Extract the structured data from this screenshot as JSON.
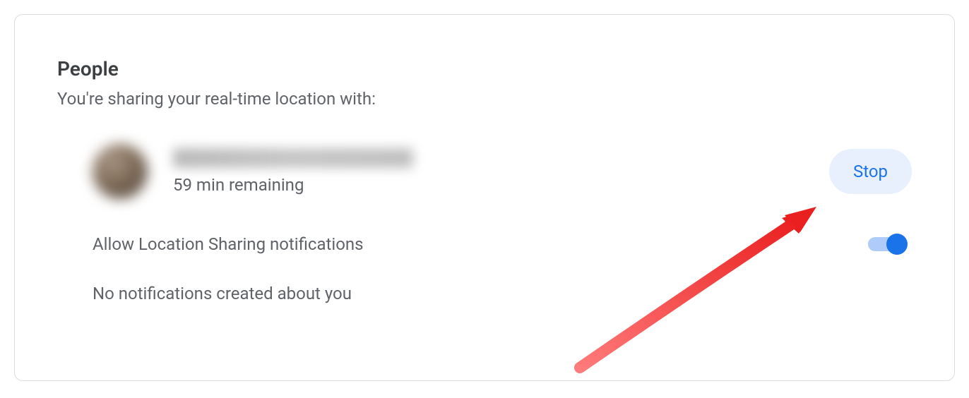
{
  "section": {
    "title": "People",
    "subtitle": "You're sharing your real-time location with:"
  },
  "person": {
    "remaining_text": "59 min remaining",
    "stop_label": "Stop"
  },
  "notifications": {
    "allow_label": "Allow Location Sharing notifications",
    "toggle_on": true,
    "empty_text": "No notifications created about you"
  }
}
